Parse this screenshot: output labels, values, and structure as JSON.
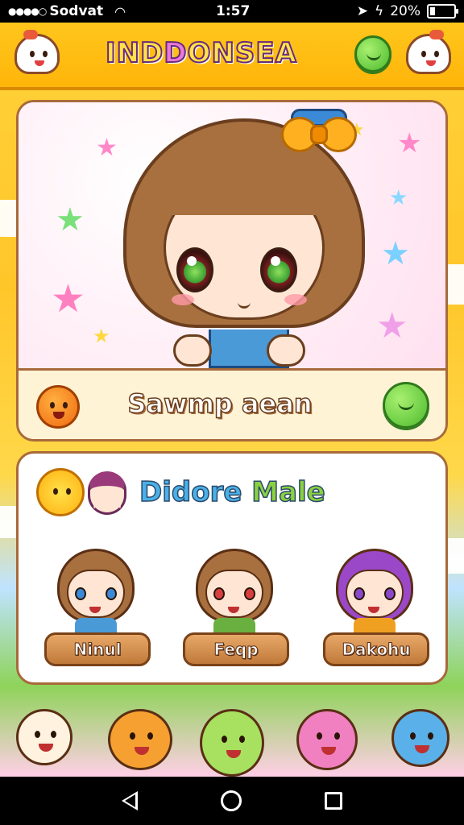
{
  "status_bar": {
    "signal_dots": "●●●●○",
    "carrier": "Sodvat",
    "time": "1:57",
    "battery": "20%",
    "battery_level": 0.2
  },
  "header": {
    "title_part1": "IND",
    "title_part2": "D",
    "title_part3": "ONSEA"
  },
  "hero": {
    "character_name": "Sawmp aean"
  },
  "friends": {
    "title_part1": "Didore ",
    "title_part2": "Male",
    "items": [
      {
        "label": "Ninul",
        "hair": "#a8703e",
        "eye": "#3a8ad8",
        "shirt": "#4a9ad8"
      },
      {
        "label": "Feqp",
        "hair": "#a8703e",
        "eye": "#d84040",
        "shirt": "#6ab040"
      },
      {
        "label": "Dakohu",
        "hair": "#9a48c8",
        "eye": "#8a4ac8",
        "shirt": "#f0a020"
      }
    ]
  },
  "colors": {
    "accent": "#ffb50a",
    "card_border": "#a86a3a",
    "button_green": "#4cba2e"
  }
}
